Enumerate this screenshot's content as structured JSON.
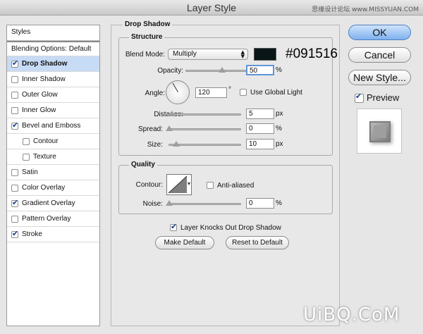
{
  "window": {
    "title": "Layer Style",
    "watermark_top": "思缘设计论坛 www.MISSYUAN.COM"
  },
  "styles_list": {
    "header": "Styles",
    "blending": "Blending Options: Default",
    "items": [
      {
        "label": "Drop Shadow",
        "checked": true,
        "selected": true,
        "indent": false
      },
      {
        "label": "Inner Shadow",
        "checked": false,
        "selected": false,
        "indent": false
      },
      {
        "label": "Outer Glow",
        "checked": false,
        "selected": false,
        "indent": false
      },
      {
        "label": "Inner Glow",
        "checked": false,
        "selected": false,
        "indent": false
      },
      {
        "label": "Bevel and Emboss",
        "checked": true,
        "selected": false,
        "indent": false
      },
      {
        "label": "Contour",
        "checked": false,
        "selected": false,
        "indent": true
      },
      {
        "label": "Texture",
        "checked": false,
        "selected": false,
        "indent": true
      },
      {
        "label": "Satin",
        "checked": false,
        "selected": false,
        "indent": false
      },
      {
        "label": "Color Overlay",
        "checked": false,
        "selected": false,
        "indent": false
      },
      {
        "label": "Gradient Overlay",
        "checked": true,
        "selected": false,
        "indent": false
      },
      {
        "label": "Pattern Overlay",
        "checked": false,
        "selected": false,
        "indent": false
      },
      {
        "label": "Stroke",
        "checked": true,
        "selected": false,
        "indent": false
      }
    ]
  },
  "drop_shadow": {
    "title": "Drop Shadow",
    "structure": {
      "title": "Structure",
      "blend_mode_label": "Blend Mode:",
      "blend_mode_value": "Multiply",
      "color": "#091516",
      "color_label": "#091516",
      "opacity_label": "Opacity:",
      "opacity_value": "50",
      "opacity_unit": "%",
      "opacity_fraction": 0.5,
      "angle_label": "Angle:",
      "angle_value": "120",
      "angle_unit": "°",
      "use_global_light_label": "Use Global Light",
      "use_global_light": false,
      "distance_label": "Distance:",
      "distance_value": "5",
      "distance_unit": "px",
      "distance_fraction": 0.02,
      "spread_label": "Spread:",
      "spread_value": "0",
      "spread_unit": "%",
      "spread_fraction": 0.0,
      "size_label": "Size:",
      "size_value": "10",
      "size_unit": "px",
      "size_fraction": 0.04
    },
    "quality": {
      "title": "Quality",
      "contour_label": "Contour:",
      "anti_aliased_label": "Anti-aliased",
      "anti_aliased": false,
      "noise_label": "Noise:",
      "noise_value": "0",
      "noise_unit": "%",
      "noise_fraction": 0.0
    },
    "knocks_out_label": "Layer Knocks Out Drop Shadow",
    "knocks_out": true,
    "make_default": "Make Default",
    "reset_default": "Reset to Default"
  },
  "buttons": {
    "ok": "OK",
    "cancel": "Cancel",
    "new_style": "New Style...",
    "preview_label": "Preview",
    "preview_checked": true
  },
  "watermark": "UiBQ.CoM"
}
